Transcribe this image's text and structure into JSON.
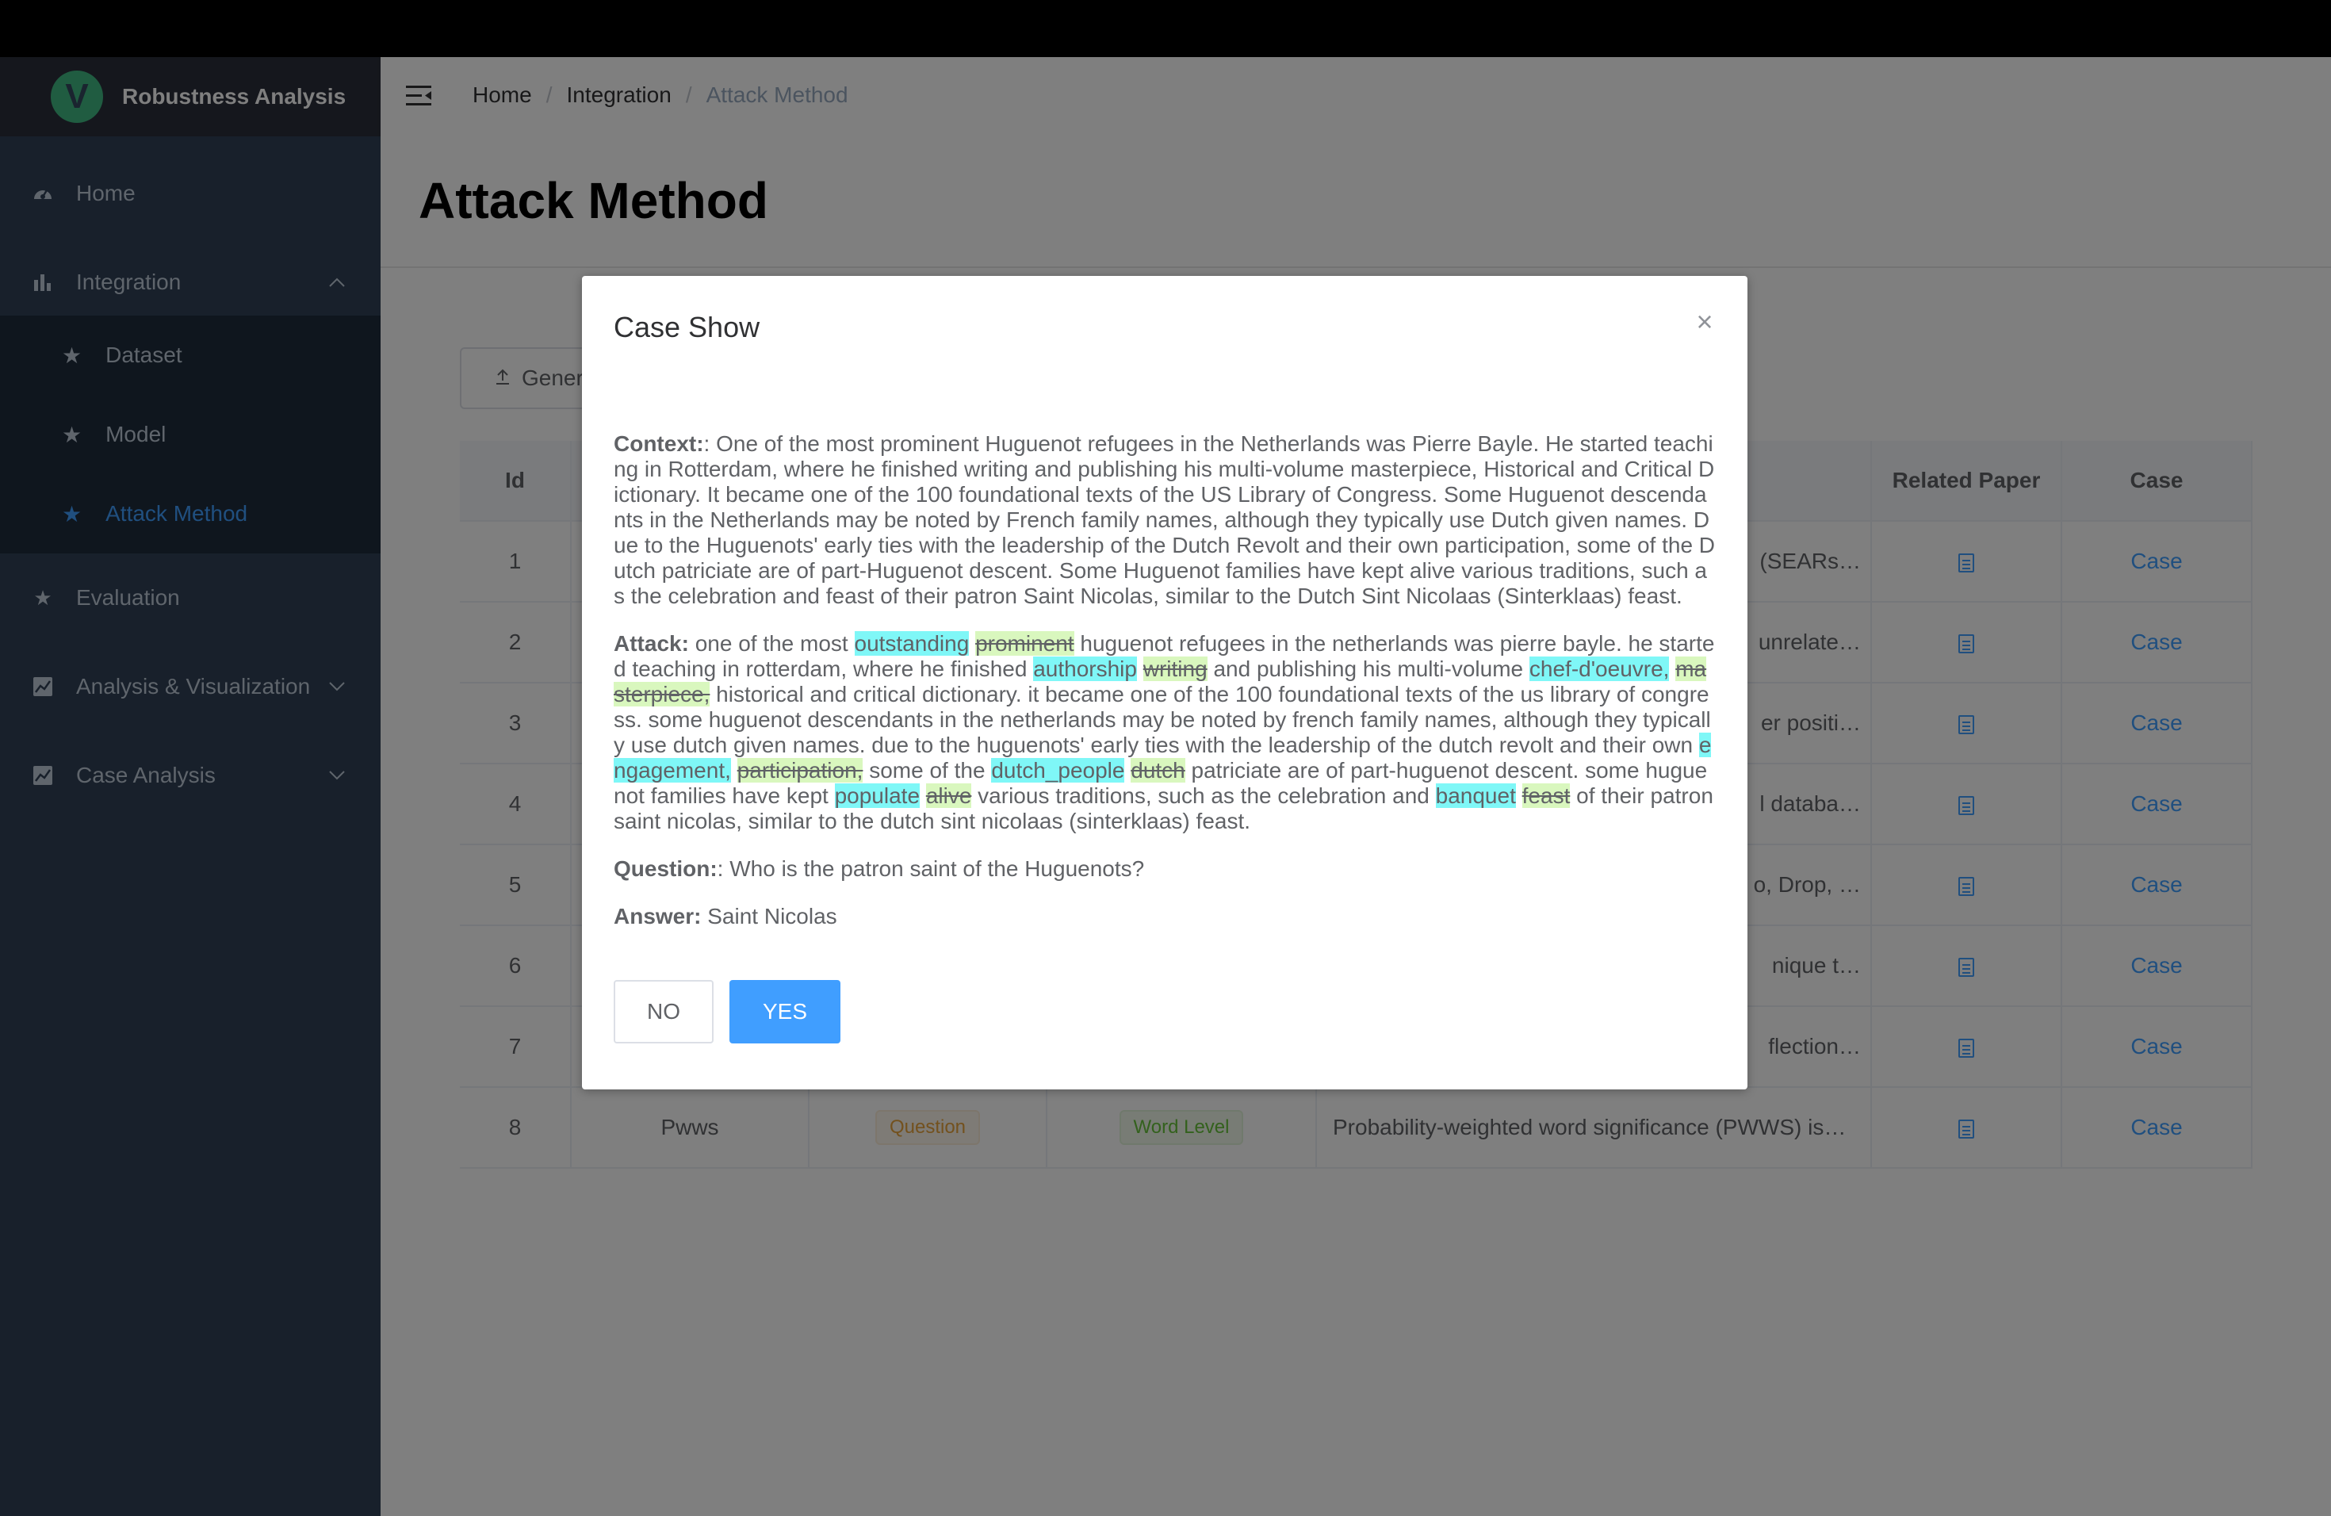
{
  "app": {
    "title": "Robustness Analysis",
    "logo_letter": "V"
  },
  "sidebar": {
    "items": [
      {
        "label": "Home",
        "icon": "dashboard-icon"
      },
      {
        "label": "Integration",
        "icon": "bar-chart-icon",
        "expanded": true
      },
      {
        "label": "Evaluation",
        "icon": "star-icon"
      },
      {
        "label": "Analysis & Visualization",
        "icon": "line-chart-icon",
        "expanded": false
      },
      {
        "label": "Case Analysis",
        "icon": "line-chart-icon",
        "expanded": false
      }
    ],
    "subitems": [
      {
        "label": "Dataset",
        "icon": "star-icon"
      },
      {
        "label": "Model",
        "icon": "star-icon"
      },
      {
        "label": "Attack Method",
        "icon": "star-icon",
        "active": true
      }
    ]
  },
  "breadcrumb": [
    "Home",
    "Integration",
    "Attack Method"
  ],
  "page": {
    "title": "Attack Method",
    "generate_button": "Gener"
  },
  "table": {
    "headers": {
      "id": "Id",
      "related_paper": "Related Paper",
      "case": "Case"
    },
    "rows": [
      {
        "id": "1",
        "desc_tail": "(SEARs…",
        "case": "Case"
      },
      {
        "id": "2",
        "desc_tail": "unrelate…",
        "case": "Case"
      },
      {
        "id": "3",
        "desc_tail": "er positi…",
        "case": "Case"
      },
      {
        "id": "4",
        "desc_tail": "l databa…",
        "case": "Case"
      },
      {
        "id": "5",
        "desc_tail": "o, Drop, …",
        "case": "Case"
      },
      {
        "id": "6",
        "desc_tail": "nique t…",
        "case": "Case"
      },
      {
        "id": "7",
        "desc_tail": "flection…",
        "case": "Case"
      },
      {
        "id": "8",
        "name": "Pwws",
        "tag1": "Question",
        "tag2": "Word Level",
        "desc": "Probability-weighted word significance (PWWS) is…",
        "case": "Case"
      }
    ]
  },
  "dialog": {
    "title": "Case Show",
    "context_label": "Context:",
    "context_text": ": One of the most prominent Huguenot refugees in the Netherlands was Pierre Bayle. He started teaching in Rotterdam, where he finished writing and publishing his multi-volume masterpiece, Historical and Critical Dictionary. It became one of the 100 foundational texts of the US Library of Congress. Some Huguenot descendants in the Netherlands may be noted by French family names, although they typically use Dutch given names. Due to the Huguenots' early ties with the leadership of the Dutch Revolt and their own participation, some of the Dutch patriciate are of part-Huguenot descent. Some Huguenot families have kept alive various traditions, such as the celebration and feast of their patron Saint Nicolas, similar to the Dutch Sint Nicolaas (Sinterklaas) feast.",
    "attack_label": "Attack:",
    "attack": {
      "t1": " one of the most ",
      "add1": "outstanding",
      "del1": "prominent",
      "t2": " huguenot refugees in the netherlands was pierre bayle. he started teaching in rotterdam, where he finished ",
      "add2": "authorship",
      "del2": "writing",
      "t3": " and publishing his multi-volume ",
      "add3": "chef-d'oeuvre,",
      "del3": "masterpiece,",
      "t4": " historical and critical dictionary. it became one of the 100 foundational texts of the us library of congress. some huguenot descendants in the netherlands may be noted by french family names, although they typically use dutch given names. due to the huguenots' early ties with the leadership of the dutch revolt and their own ",
      "add4": "engagement,",
      "del4": "participation,",
      "t5": " some of the ",
      "add5": "dutch_people",
      "del5": "dutch",
      "t6": " patriciate are of part-huguenot descent. some huguenot families have kept ",
      "add6": "populate",
      "del6": "alive",
      "t7": " various traditions, such as the celebration and ",
      "add7": "banquet",
      "del7": "feast",
      "t8": " of their patron saint nicolas, similar to the dutch sint nicolaas (sinterklaas) feast."
    },
    "question_label": "Question:",
    "question_text": ": Who is the patron saint of the Huguenots?",
    "answer_label": "Answer:",
    "answer_text": " Saint Nicolas",
    "no_button": "NO",
    "yes_button": "YES",
    "close_symbol": "×"
  },
  "colors": {
    "sidebar_bg": "#304156",
    "submenu_bg": "#1f2d3d",
    "accent": "#409eff",
    "highlight_added": "#7ff7f7",
    "highlight_removed": "#d9f7be"
  }
}
